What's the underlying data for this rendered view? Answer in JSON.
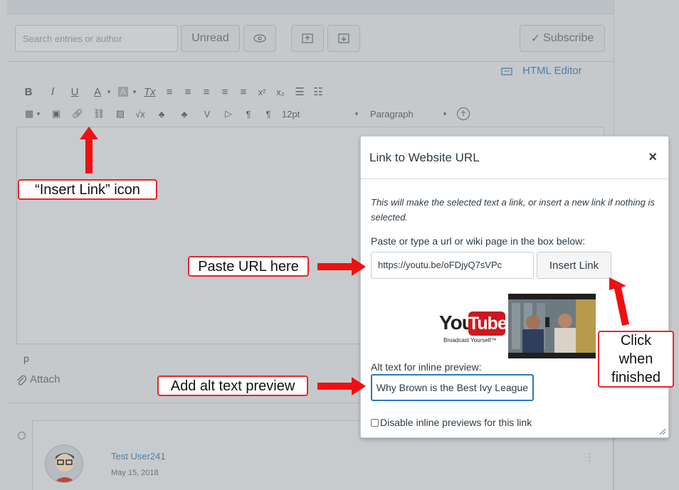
{
  "toolbar": {
    "search_placeholder": "Search entries or author",
    "unread_label": "Unread",
    "subscribe_label": "Subscribe",
    "subscribe_check": "✓"
  },
  "editor": {
    "html_editor_label": "HTML Editor",
    "font_size": "12pt",
    "paragraph_style": "Paragraph",
    "path_label": "p",
    "attach_label": "Attach",
    "format_buttons": [
      "B",
      "I",
      "U",
      "A",
      "A",
      "Tx"
    ],
    "pilcrow": "¶"
  },
  "reply": {
    "user_name": "Test User241",
    "date": "May 15, 2018"
  },
  "modal": {
    "title": "Link to Website URL",
    "close": "×",
    "description": "This will make the selected text a link, or insert a new link if nothing is selected.",
    "instruction": "Paste or type a url or wiki page in the box below:",
    "url_value": "https://youtu.be/oFDjyQ7sVPc",
    "insert_button": "Insert Link",
    "youtube_you": "You",
    "youtube_tube": "Tube",
    "youtube_tagline": "Broadcast Yourself™",
    "alt_label": "Alt text for inline preview:",
    "alt_value": "Why Brown is the Best Ivy League",
    "disable_label": "Disable inline previews for this link"
  },
  "annotations": {
    "insert_link_icon": "“Insert Link” icon",
    "paste_url": "Paste URL here",
    "add_alt": "Add alt text preview",
    "click_finished": "Click when finished",
    "callout_color": "#e8252b",
    "arrow_color": "#ee1111"
  }
}
